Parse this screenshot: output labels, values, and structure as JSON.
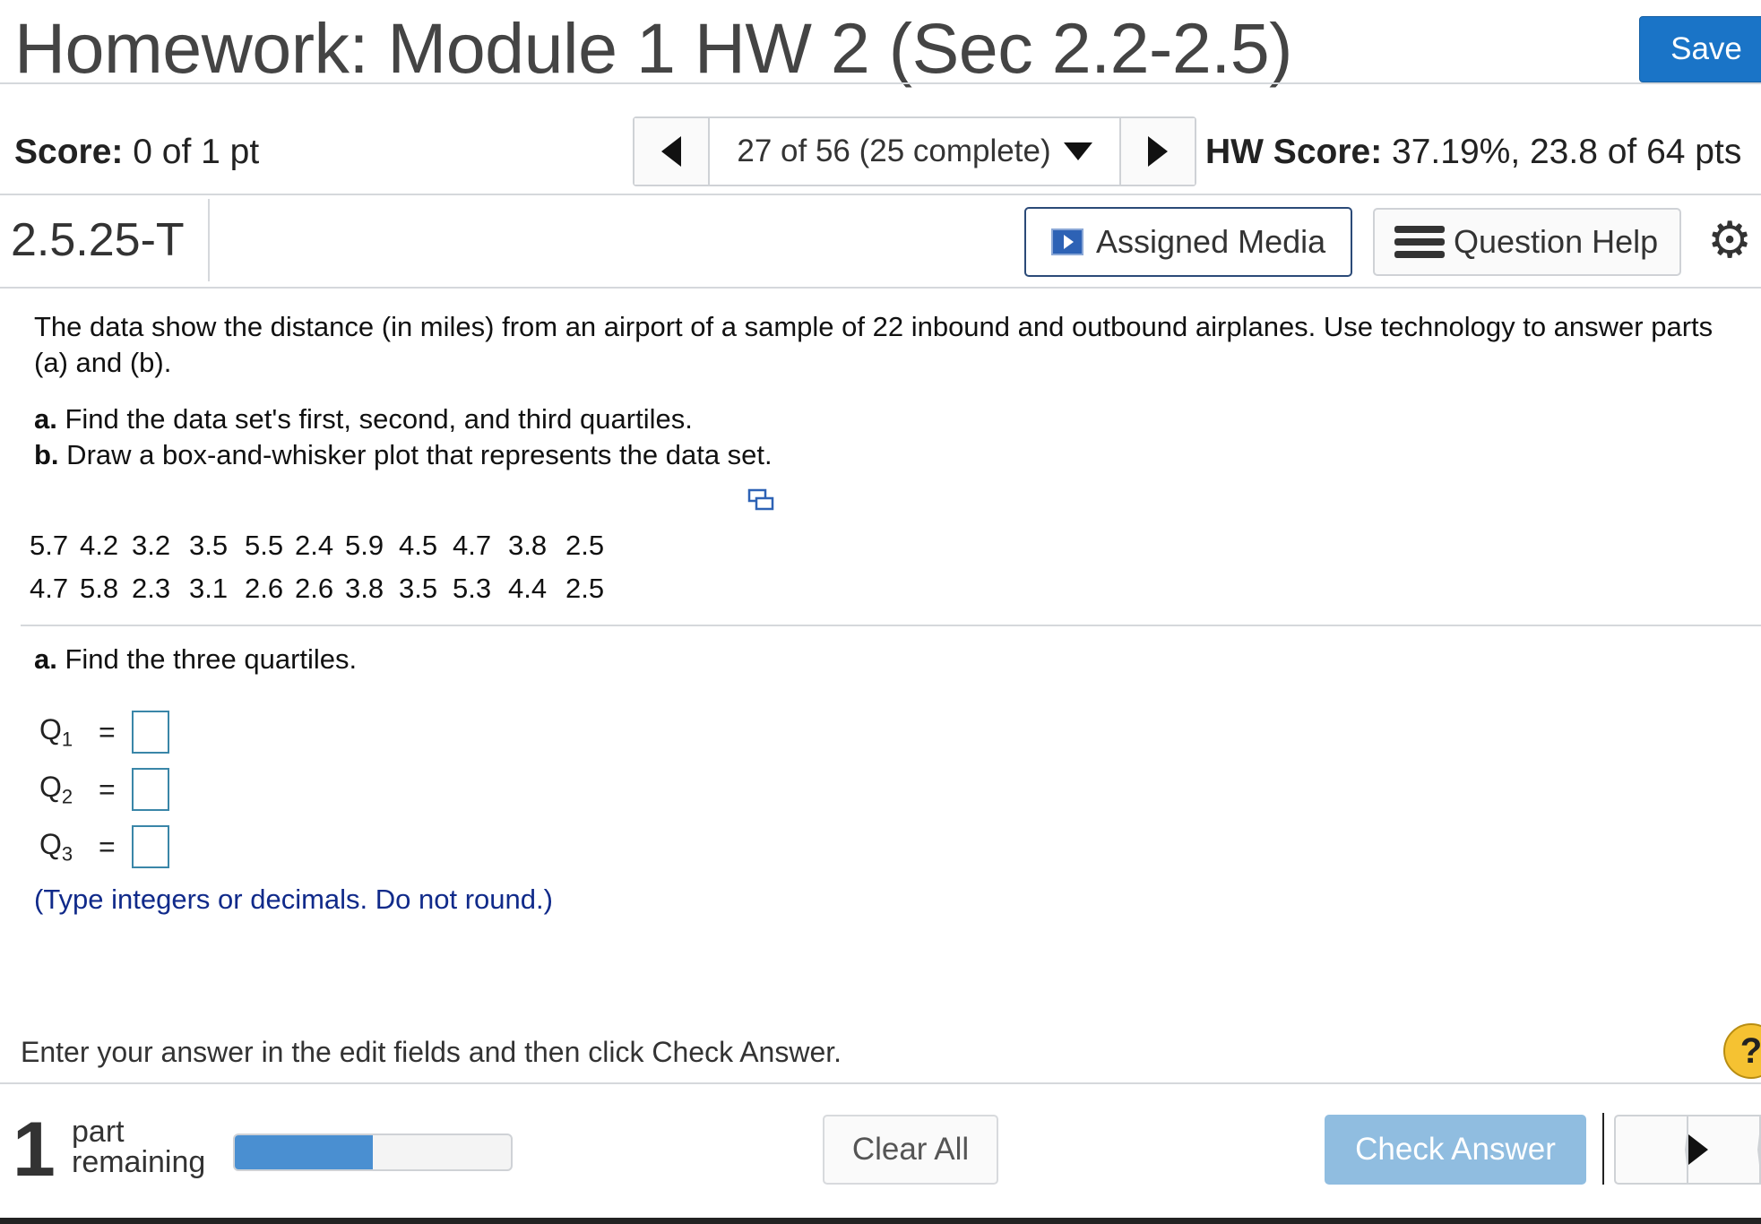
{
  "header": {
    "title": "Homework: Module 1 HW 2 (Sec 2.2-2.5)",
    "save_label": "Save"
  },
  "score_bar": {
    "score_label": "Score:",
    "score_value": "0 of 1 pt",
    "nav_text": "27 of 56 (25 complete)",
    "hw_score_label": "HW Score:",
    "hw_score_value": "37.19%, 23.8 of 64 pts"
  },
  "question_bar": {
    "question_id": "2.5.25-T",
    "assigned_media_label": "Assigned Media",
    "question_help_label": "Question Help"
  },
  "problem": {
    "statement": "The data show the distance (in miles) from an airport of a sample of 22 inbound and outbound airplanes. Use technology to answer parts (a) and (b).",
    "part_a_tag": "a.",
    "part_a_text": " Find the data set's first, second, and third quartiles.",
    "part_b_tag": "b.",
    "part_b_text": " Draw a box-and-whisker plot that represents the data set.",
    "data_rows": [
      [
        "5.7",
        "4.2",
        "3.2",
        "3.5",
        "5.5",
        "2.4",
        "5.9",
        "4.5",
        "4.7",
        "3.8",
        "2.5"
      ],
      [
        "4.7",
        "5.8",
        "2.3",
        "3.1",
        "2.6",
        "2.6",
        "3.8",
        "3.5",
        "5.3",
        "4.4",
        "2.5"
      ]
    ]
  },
  "answer": {
    "heading_tag": "a.",
    "heading_text": " Find the three quartiles.",
    "q_letter": "Q",
    "q1_sub": "1",
    "q2_sub": "2",
    "q3_sub": "3",
    "equals": "=",
    "q1_value": "",
    "q2_value": "",
    "q3_value": "",
    "hint": "(Type integers or decimals. Do not round.)"
  },
  "footer": {
    "instruction": "Enter your answer in the edit fields and then click Check Answer.",
    "help_symbol": "?",
    "parts_remaining_count": "1",
    "parts_remaining_line1": "part",
    "parts_remaining_line2": "remaining",
    "progress_fraction": 0.5,
    "clear_all_label": "Clear All",
    "check_answer_label": "Check Answer"
  },
  "icons": {
    "media": "play-video-icon",
    "help": "list-icon",
    "settings": "gear-icon",
    "data_copy": "copy-data-icon"
  },
  "colors": {
    "save_button": "#1a74c7",
    "check_answer_button": "#90bde0",
    "hint_text": "#102a8a",
    "progress_fill": "#4a8fd1",
    "help_circle": "#f5c232"
  }
}
